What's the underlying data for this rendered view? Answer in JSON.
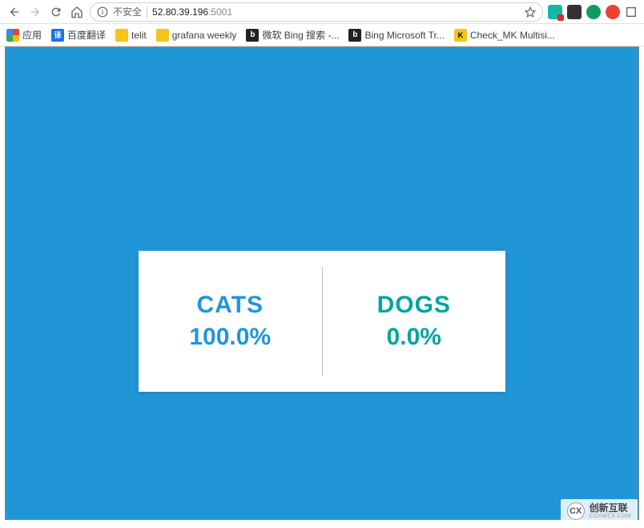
{
  "address_bar": {
    "insecure_text": "不安全",
    "host": "52.80.39.196",
    "port": ":5001"
  },
  "bookmarks": {
    "apps": "应用",
    "baidu_translate": "百度翻译",
    "telit": "telit",
    "grafana": "grafana weekly",
    "bing_cn": "微软 Bing 搜索 -...",
    "bing_ms": "Bing Microsoft Tr...",
    "check_mk": "Check_MK Multisi..."
  },
  "results": {
    "cats_label": "CATS",
    "cats_value": "100.0%",
    "dogs_label": "DOGS",
    "dogs_value": "0.0%"
  },
  "watermark": {
    "logo": "CX",
    "main": "创新互联",
    "sub": "CDXWCX.COM"
  },
  "chart_data": {
    "type": "bar",
    "categories": [
      "CATS",
      "DOGS"
    ],
    "values": [
      100.0,
      0.0
    ],
    "title": "",
    "xlabel": "",
    "ylabel": "%",
    "ylim": [
      0,
      100
    ]
  }
}
